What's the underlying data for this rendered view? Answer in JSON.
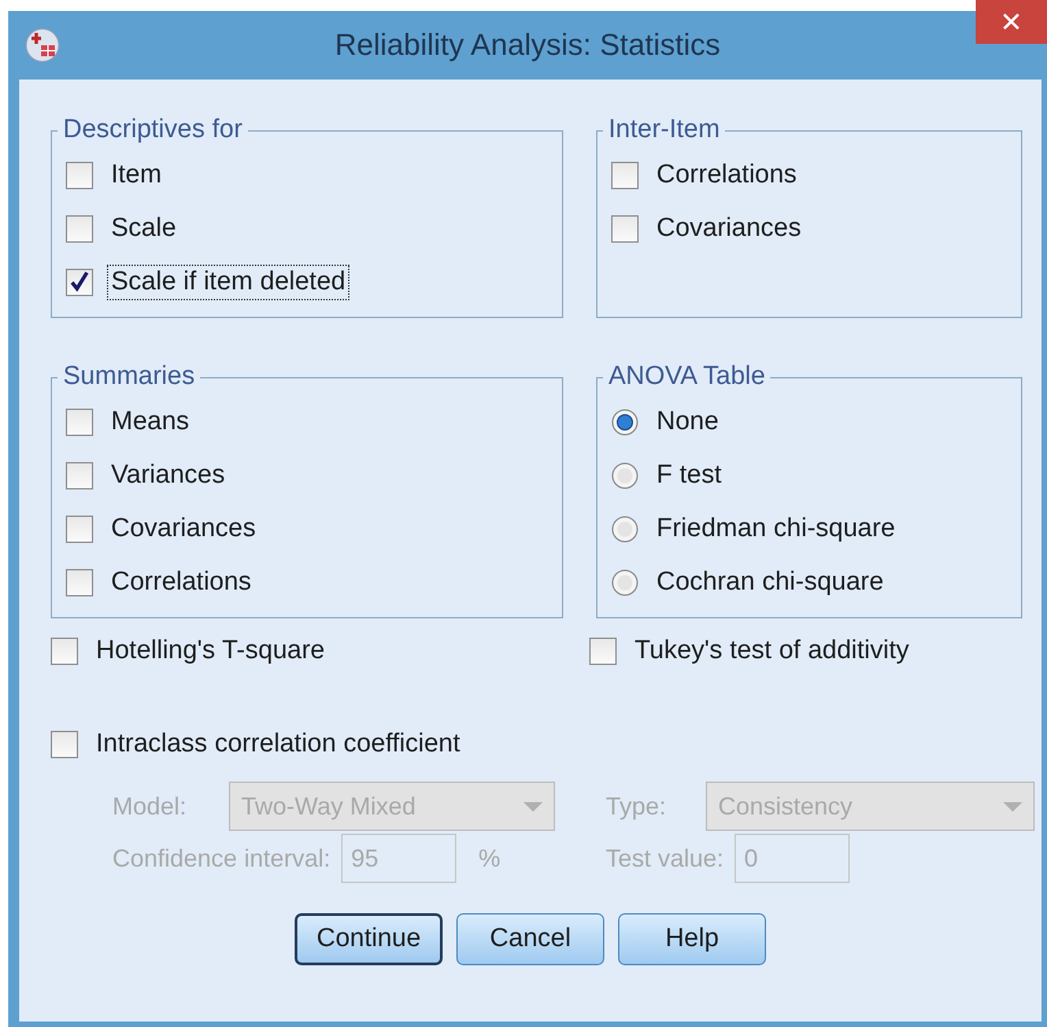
{
  "window": {
    "title": "Reliability Analysis: Statistics",
    "close": "✕"
  },
  "descriptives": {
    "title": "Descriptives for",
    "items": [
      {
        "label": "Item",
        "checked": false,
        "focused": false
      },
      {
        "label": "Scale",
        "checked": false,
        "focused": false
      },
      {
        "label": "Scale if item deleted",
        "checked": true,
        "focused": true
      }
    ]
  },
  "inter_item": {
    "title": "Inter-Item",
    "items": [
      {
        "label": "Correlations",
        "checked": false,
        "focused": false
      },
      {
        "label": "Covariances",
        "checked": false,
        "focused": false
      }
    ]
  },
  "summaries": {
    "title": "Summaries",
    "items": [
      {
        "label": "Means",
        "checked": false,
        "focused": false
      },
      {
        "label": "Variances",
        "checked": false,
        "focused": false
      },
      {
        "label": "Covariances",
        "checked": false,
        "focused": false
      },
      {
        "label": "Correlations",
        "checked": false,
        "focused": false
      }
    ]
  },
  "anova": {
    "title": "ANOVA Table",
    "options": [
      {
        "label": "None",
        "selected": true
      },
      {
        "label": "F test",
        "selected": false
      },
      {
        "label": "Friedman chi-square",
        "selected": false
      },
      {
        "label": "Cochran chi-square",
        "selected": false
      }
    ]
  },
  "hotelling": {
    "label": "Hotelling's T-square",
    "checked": false,
    "focused": false
  },
  "tukey": {
    "label": "Tukey's test of additivity",
    "checked": false,
    "focused": false
  },
  "intraclass": {
    "label": "Intraclass correlation coefficient",
    "checked": false,
    "focused": false
  },
  "icc": {
    "disabled": true,
    "model": {
      "label": "Model:",
      "value": "Two-Way Mixed"
    },
    "type": {
      "label": "Type:",
      "value": "Consistency"
    },
    "confidence": {
      "label": "Confidence interval:",
      "value": "95",
      "unit": "%"
    },
    "test_value": {
      "label": "Test value:",
      "value": "0"
    }
  },
  "buttons": [
    {
      "label": "Continue",
      "default": true
    },
    {
      "label": "Cancel",
      "default": false
    },
    {
      "label": "Help",
      "default": false
    }
  ]
}
